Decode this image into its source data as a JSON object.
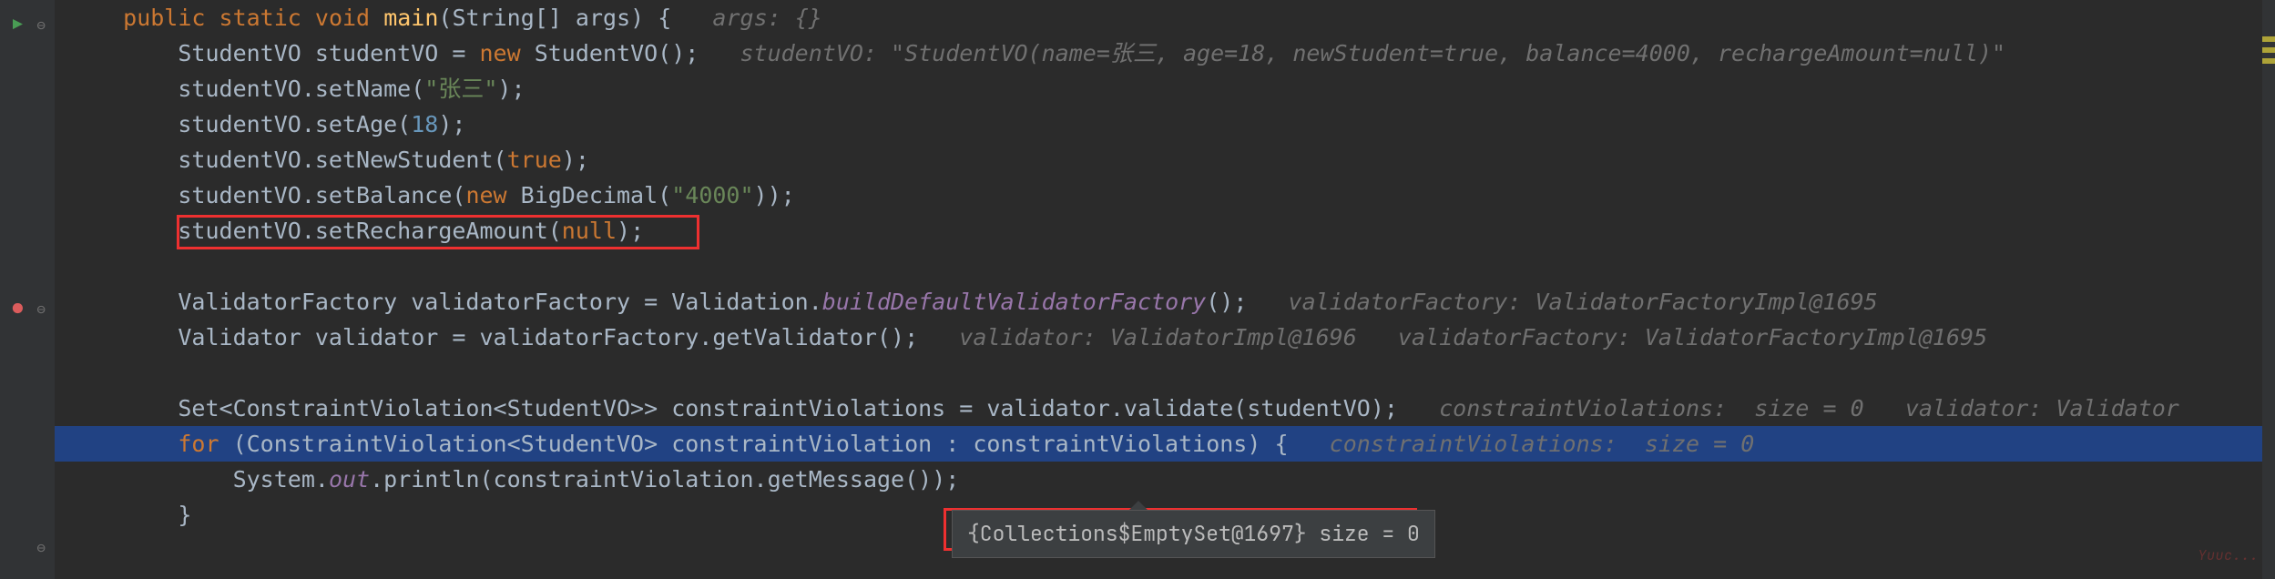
{
  "gutter": {
    "run_icon": "▶",
    "breakpoint_icon": "●",
    "fold_open": "⊖",
    "fold_close": "⊖"
  },
  "code": {
    "l1": {
      "kw1": "public",
      "kw2": "static",
      "kw3": "void",
      "mtd": "main",
      "sig1": "(String[] args) {",
      "inlay": "   args: {}"
    },
    "l2": {
      "t1": "StudentVO studentVO = ",
      "kw": "new",
      "t2": " StudentVO();",
      "inlay": "   studentVO: \"StudentVO(name=张三, age=18, newStudent=true, balance=4000, rechargeAmount=null)\""
    },
    "l3": {
      "t1": "studentVO.setName(",
      "str": "\"张三\"",
      "t2": ");"
    },
    "l4": {
      "t1": "studentVO.setAge(",
      "num": "18",
      "t2": ");"
    },
    "l5": {
      "t1": "studentVO.setNewStudent(",
      "kw": "true",
      "t2": ");"
    },
    "l6": {
      "t1": "studentVO.setBalance(",
      "kw": "new",
      "t2": " BigDecimal(",
      "str": "\"4000\"",
      "t3": "));"
    },
    "l7": {
      "t1": "studentVO.setRechargeAmount(",
      "kw": "null",
      "t2": ");"
    },
    "l9": {
      "t1": "ValidatorFactory validatorFactory = Validation.",
      "mtd": "buildDefaultValidatorFactory",
      "t2": "();",
      "inlay": "   validatorFactory: ValidatorFactoryImpl@1695"
    },
    "l10": {
      "t1": "Validator validator = validatorFactory.getValidator();",
      "inlay": "   validator: ValidatorImpl@1696   validatorFactory: ValidatorFactoryImpl@1695"
    },
    "l12": {
      "t1": "Set<ConstraintViolation<StudentVO>> constraintViolations = validator.validate(studentVO);",
      "inlay": "   constraintViolations:  size = 0   validator: Validator"
    },
    "l13": {
      "kw": "for",
      "t1": " (ConstraintViolation<StudentVO> constraintViolation : constraintViolations) {",
      "inlay": "   constraintViolations:  size = 0"
    },
    "l14": {
      "t1": "System.",
      "fld": "out",
      "t2": ".println(constraintViolation.getMessage());"
    },
    "l15": {
      "t1": "}"
    }
  },
  "tooltip": {
    "text": "{Collections$EmptySet@1697} size = 0"
  },
  "watermark": "Yuuc..."
}
